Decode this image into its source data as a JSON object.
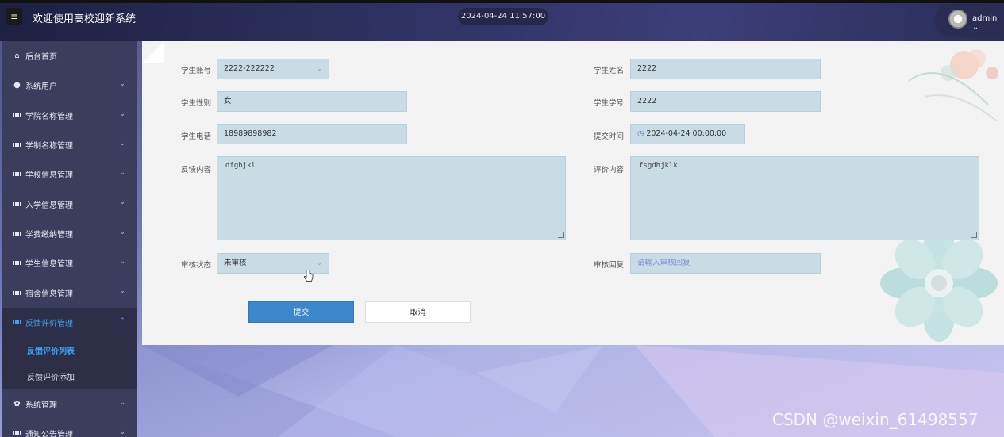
{
  "header": {
    "menu_icon": "hamburger-icon",
    "title": "欢迎使用高校迎新系统",
    "datetime": "2024-04-24 11:57:00",
    "username": "admin"
  },
  "sidebar": {
    "items": [
      {
        "label": "后台首页",
        "icon": "home-icon",
        "expandable": false
      },
      {
        "label": "系统用户",
        "icon": "user-icon",
        "expandable": true
      },
      {
        "label": "学院名称管理",
        "icon": "grid-icon",
        "expandable": true
      },
      {
        "label": "学制名称管理",
        "icon": "grid-icon",
        "expandable": true
      },
      {
        "label": "学校信息管理",
        "icon": "grid-icon",
        "expandable": true
      },
      {
        "label": "入学信息管理",
        "icon": "grid-icon",
        "expandable": true
      },
      {
        "label": "学费缴纳管理",
        "icon": "grid-icon",
        "expandable": true
      },
      {
        "label": "学生信息管理",
        "icon": "grid-icon",
        "expandable": true
      },
      {
        "label": "宿舍信息管理",
        "icon": "grid-icon",
        "expandable": true
      },
      {
        "label": "反馈评价管理",
        "icon": "grid-icon",
        "expandable": true,
        "active": true
      }
    ],
    "submenu": [
      {
        "label": "反馈评价列表",
        "current": true
      },
      {
        "label": "反馈评价添加",
        "current": false
      }
    ],
    "items_after": [
      {
        "label": "系统管理",
        "icon": "gear-icon",
        "expandable": true
      },
      {
        "label": "通知公告管理",
        "icon": "grid-icon",
        "expandable": true
      }
    ]
  },
  "form": {
    "student_account": {
      "label": "学生账号",
      "value": "2222-222222"
    },
    "student_name": {
      "label": "学生姓名",
      "value": "2222"
    },
    "student_gender": {
      "label": "学生性别",
      "value": "女"
    },
    "student_number": {
      "label": "学生学号",
      "value": "2222"
    },
    "student_phone": {
      "label": "学生电话",
      "value": "18989898982"
    },
    "submit_time": {
      "label": "提交时间",
      "value": "2024-04-24 00:00:00"
    },
    "feedback_content": {
      "label": "反馈内容",
      "value": "dfghjkl"
    },
    "evaluation_content": {
      "label": "评价内容",
      "value": "fsgdhjklk"
    },
    "review_status": {
      "label": "审核状态",
      "value": "未审核"
    },
    "review_reply": {
      "label": "审核回复",
      "placeholder": "请输入审核回复"
    }
  },
  "buttons": {
    "submit": "提交",
    "cancel": "取消"
  },
  "watermark": "CSDN @weixin_61498557",
  "colors": {
    "accent": "#3ba4f5",
    "primary_button": "#3c86cc",
    "input_bg": "#c9dce6",
    "sidebar_bg": "#3a3d5c"
  }
}
